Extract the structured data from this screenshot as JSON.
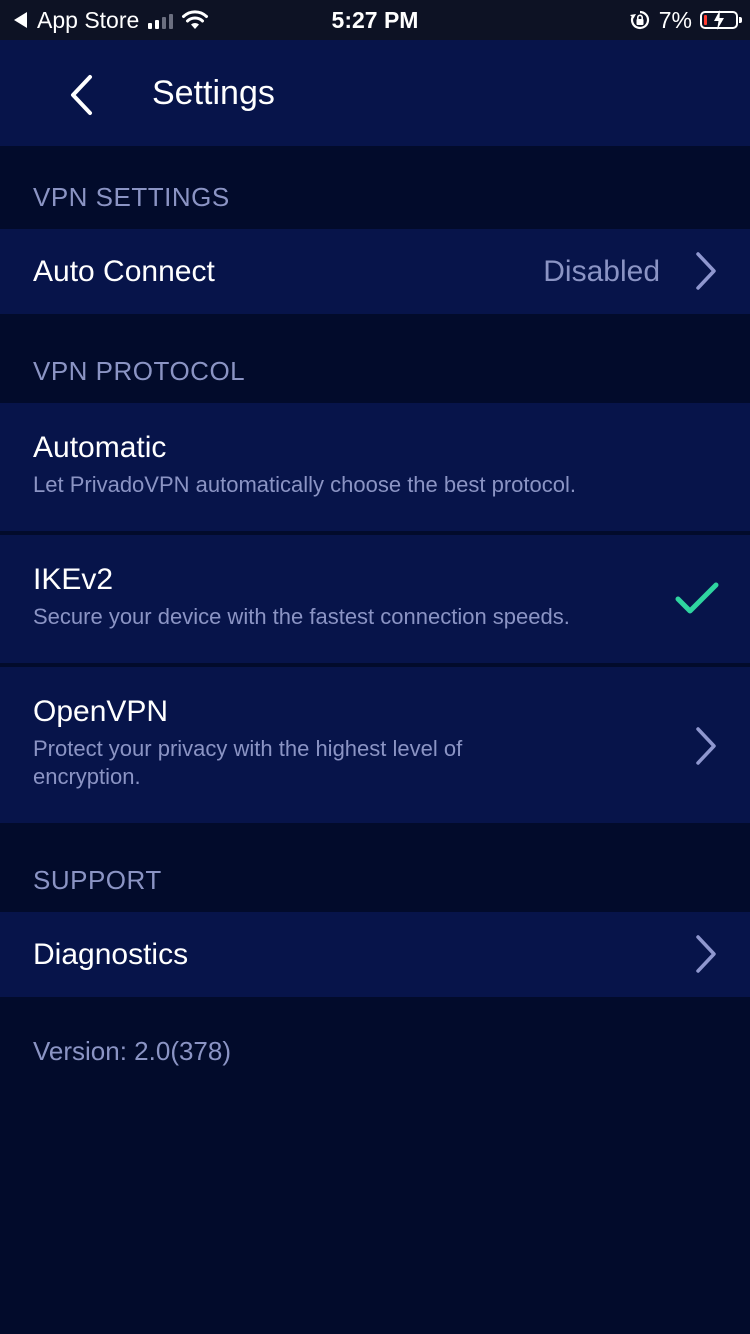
{
  "status_bar": {
    "back_app": "App Store",
    "time": "5:27 PM",
    "battery_percent": "7%",
    "icons": [
      "back-triangle-icon",
      "signal-icon",
      "wifi-icon",
      "orientation-lock-icon",
      "battery-charging-icon"
    ],
    "battery_level": 0.07
  },
  "header": {
    "title": "Settings",
    "back_icon": "chevron-left-icon"
  },
  "sections": {
    "vpn_settings": {
      "label": "VPN SETTINGS",
      "auto_connect": {
        "title": "Auto Connect",
        "value": "Disabled"
      }
    },
    "vpn_protocol": {
      "label": "VPN PROTOCOL",
      "items": [
        {
          "title": "Automatic",
          "subtitle": "Let PrivadoVPN automatically choose the best protocol.",
          "selected": false
        },
        {
          "title": "IKEv2",
          "subtitle": "Secure your device with the fastest connection speeds.",
          "selected": true
        },
        {
          "title": "OpenVPN",
          "subtitle_line1": "Protect your privacy with the highest level of",
          "subtitle_line2": "encryption.",
          "selected": false
        }
      ]
    },
    "support": {
      "label": "SUPPORT",
      "diagnostics": {
        "title": "Diagnostics"
      }
    }
  },
  "footer": {
    "version": "Version: 2.0(378)"
  },
  "colors": {
    "background": "#020b2b",
    "row": "#07144a",
    "secondary_text": "#8b94c4",
    "check": "#2fd4a0",
    "chevron": "#8f97cf",
    "battery_low": "#ff3b30"
  }
}
